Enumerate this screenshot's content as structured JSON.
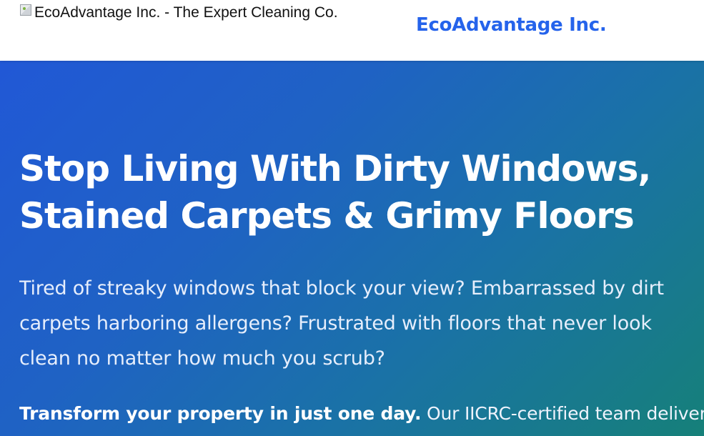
{
  "header": {
    "logo_alt": "EcoAdvantage Inc. - The Expert Cleaning Co.",
    "brand_name": "EcoAdvantage Inc."
  },
  "hero": {
    "headline_line1": "Stop Living With Dirty Windows,",
    "headline_line2": "Stained Carpets & Grimy Floors",
    "subtext_line1": "Tired of streaky windows that block your view? Embarrassed by dirt",
    "subtext_line2": "carpets harboring allergens? Frustrated with floors that never look",
    "subtext_line3": "clean no matter how much you scrub?",
    "transform_bold": "Transform your property in just one day.",
    "transform_rest": " Our IICRC-certified team delivers"
  },
  "colors": {
    "brand_blue": "#2563eb",
    "hero_gradient_start": "#2158d6",
    "hero_gradient_end": "#168079"
  },
  "icons": {
    "logo": "broken-image-icon"
  }
}
